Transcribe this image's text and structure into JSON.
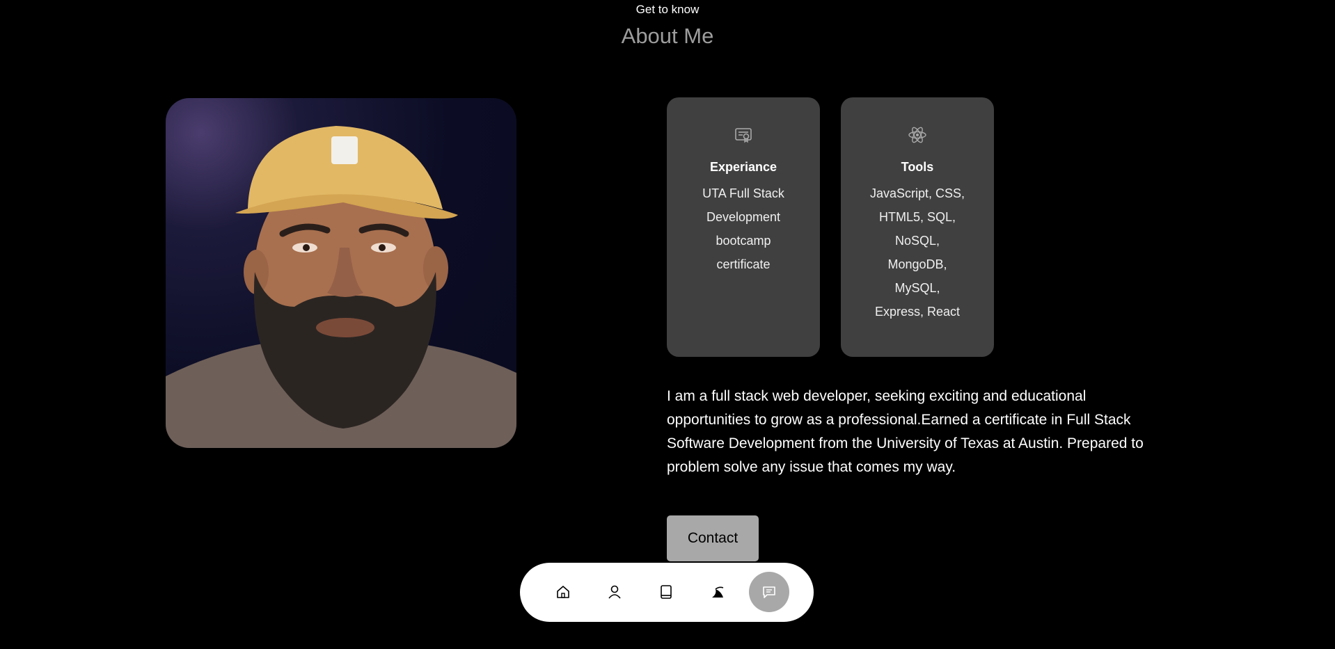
{
  "header": {
    "subtitle": "Get to know",
    "title": "About Me"
  },
  "photo": {
    "alt": "Profile photo of a bearded man wearing a yellow cap"
  },
  "cards": [
    {
      "icon": "certificate-icon",
      "title": "Experiance",
      "body": "UTA Full Stack Development bootcamp certificate"
    },
    {
      "icon": "react-icon",
      "title": "Tools",
      "body": "JavaScript, CSS, HTML5, SQL, NoSQL, MongoDB, MySQL, Express, React"
    }
  ],
  "bio": "I am a full stack web developer, seeking exciting and educational opportunities to grow as a professional.Earned a certificate in Full Stack Software Development from the University of Texas at Austin. Prepared to problem solve any issue that comes my way.",
  "contact_label": "Contact",
  "nav": {
    "items": [
      {
        "icon": "home-icon",
        "active": false
      },
      {
        "icon": "user-icon",
        "active": false
      },
      {
        "icon": "book-icon",
        "active": false
      },
      {
        "icon": "services-icon",
        "active": false
      },
      {
        "icon": "message-icon",
        "active": true
      }
    ]
  },
  "colors": {
    "background": "#000000",
    "card": "#404040",
    "title_gray": "#9d9d9d",
    "button": "#a8a8a8",
    "navbar": "#ffffff"
  }
}
